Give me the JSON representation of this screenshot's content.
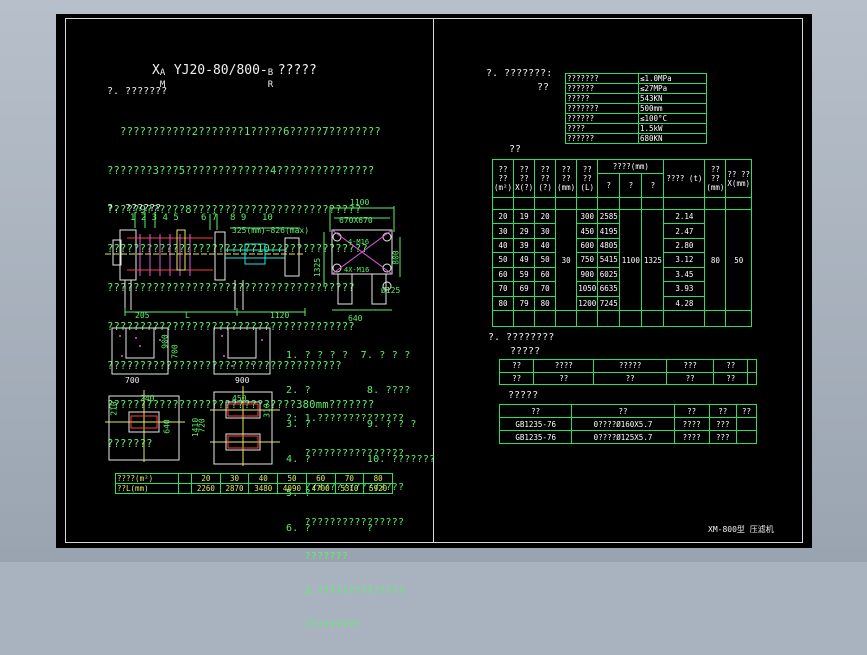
{
  "title": {
    "prefix": "X",
    "sup": "A",
    "sub": "M",
    "main": "YJ20-80/800-",
    "tail_sup": "B",
    "tail_sub": "R",
    "suffix": "?????"
  },
  "sections": {
    "s1": "?. ???????",
    "s2": "?. ??????",
    "s3": "?. ???????:",
    "s3_sub": "??",
    "s4": "??",
    "s5": "?. ????????",
    "s5_sub": "?????",
    "s6": "?????"
  },
  "desc_lines": [
    "  ???????????2???????1?????6?????7????????",
    "???????3???5?????????????4???????????????",
    "?????9??????8??????????????????????????",
    "???????????????????????10???????????????",
    "??????????????????????????????????????",
    "??????????????????????????????????????",
    "????????????????????????????????????",
    "?????????????????????????????380mm???????",
    "???????"
  ],
  "drawing_labels": {
    "parts": "1 2 3 4 5",
    "p67": "6  7",
    "p89": "8  9",
    "p10": "10",
    "stroke": "325(mm)~826(max)",
    "d205": "205",
    "dL": "L",
    "d1120": "1120",
    "d1100": "1100",
    "d670": "670X670",
    "d640": "640",
    "d1325": "1325",
    "d800": "800",
    "d4m": "4-M16",
    "d4m2": "4X-M16",
    "d125": "Ø125",
    "f900a": "900",
    "f700a": "700",
    "f700b": "700",
    "f900b": "900",
    "f240": "240",
    "f450": "450",
    "f1410": "1410",
    "f310": "310",
    "f210": "210",
    "f640": "640",
    "f720": "720"
  },
  "legend_lines": [
    "1. ? ? ? ?  7. ? ? ?",
    "2. ?         8. ????",
    "3. ?         9. ? ? ?",
    "4. ?         10. ???????",
    "5. ?",
    "6. ?         ?"
  ],
  "notes_lines": [
    "?: 1.??????????????",
    "   ????????????????",
    "   ????????????????",
    "   ????????????????",
    "   ???????",
    "   2.??????????????",
    "   ?????????"
  ],
  "bottom_table": [
    [
      "????(m²)",
      "20",
      "30",
      "40",
      "50",
      "60",
      "70",
      "80"
    ],
    [
      "??L(mm)",
      "2260",
      "2870",
      "3480",
      "4090",
      "4700",
      "5310",
      "5920"
    ]
  ],
  "params_table": [
    [
      "???????",
      "≤1.0MPa"
    ],
    [
      "??????",
      "≤27MPa"
    ],
    [
      "?????",
      "543KN"
    ],
    [
      "???????",
      "500mm"
    ],
    [
      "??????",
      "≤100°C"
    ],
    [
      "????",
      "1.5kW"
    ],
    [
      "??????",
      "680KN"
    ]
  ],
  "spec_table": {
    "headers": [
      "?? ?? (m²)",
      "?? ?? X(?)",
      "?? ?? (?)",
      "?? ?? (mm)",
      "?? ?? (L)",
      "????(mm)",
      "???? (t)",
      "?? ?? (mm)",
      "?? ?? X(mm)"
    ],
    "subheaders": [
      "?",
      "?",
      "?"
    ],
    "rows": [
      [
        "20",
        "19",
        "20",
        "300",
        "2585",
        "2.14"
      ],
      [
        "30",
        "29",
        "30",
        "450",
        "4195",
        "2.47"
      ],
      [
        "40",
        "39",
        "40",
        "600",
        "4805",
        "2.80"
      ],
      [
        "50",
        "49",
        "50",
        "750",
        "5415",
        "3.12"
      ],
      [
        "60",
        "59",
        "60",
        "900",
        "6025",
        "3.45"
      ],
      [
        "70",
        "69",
        "70",
        "1050",
        "6635",
        "3.93"
      ],
      [
        "80",
        "79",
        "80",
        "1200",
        "7245",
        "4.28"
      ]
    ],
    "merged": {
      "thickness": "30",
      "w1": "1100",
      "w2": "1325",
      "m1": "80",
      "m2": "50"
    }
  },
  "motor_table": {
    "headers": [
      "??",
      "????",
      "?????",
      "???",
      "??"
    ],
    "rows": [
      [
        "??",
        "??",
        "??",
        "??",
        "??"
      ]
    ]
  },
  "material_table": {
    "headers": [
      "??",
      "??",
      "??",
      "??",
      "??"
    ],
    "rows": [
      [
        "GB1235-76",
        "0????Ø160X5.7",
        "????",
        "???",
        ""
      ],
      [
        "GB1235-76",
        "0????Ø125X5.7",
        "????",
        "???",
        ""
      ]
    ]
  },
  "footer_label": "XM-800型 压滤机"
}
